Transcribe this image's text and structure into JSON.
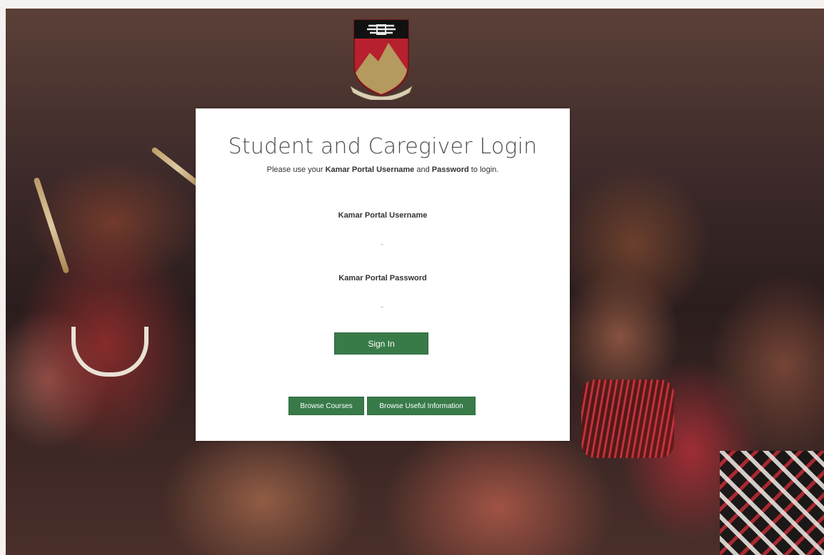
{
  "login": {
    "title": "Student and Caregiver Login",
    "instructions": {
      "prefix": "Please use your ",
      "username_term": "Kamar Portal Username",
      "connector": " and ",
      "password_term": "Password",
      "suffix": " to login."
    },
    "username_label": "Kamar Portal Username",
    "username_value": "",
    "password_label": "Kamar Portal Password",
    "password_value": "",
    "sign_in_label": "Sign In"
  },
  "links": {
    "browse_courses_label": "Browse Courses",
    "browse_info_label": "Browse Useful Information"
  },
  "crest": {
    "icon": "school-crest-icon",
    "colors": {
      "shield_red": "#b7202e",
      "mountain_gold": "#b49a5f",
      "banner_black": "#111111"
    }
  },
  "colors": {
    "button_green": "#387b49",
    "title_grey": "#4c4c4c"
  }
}
